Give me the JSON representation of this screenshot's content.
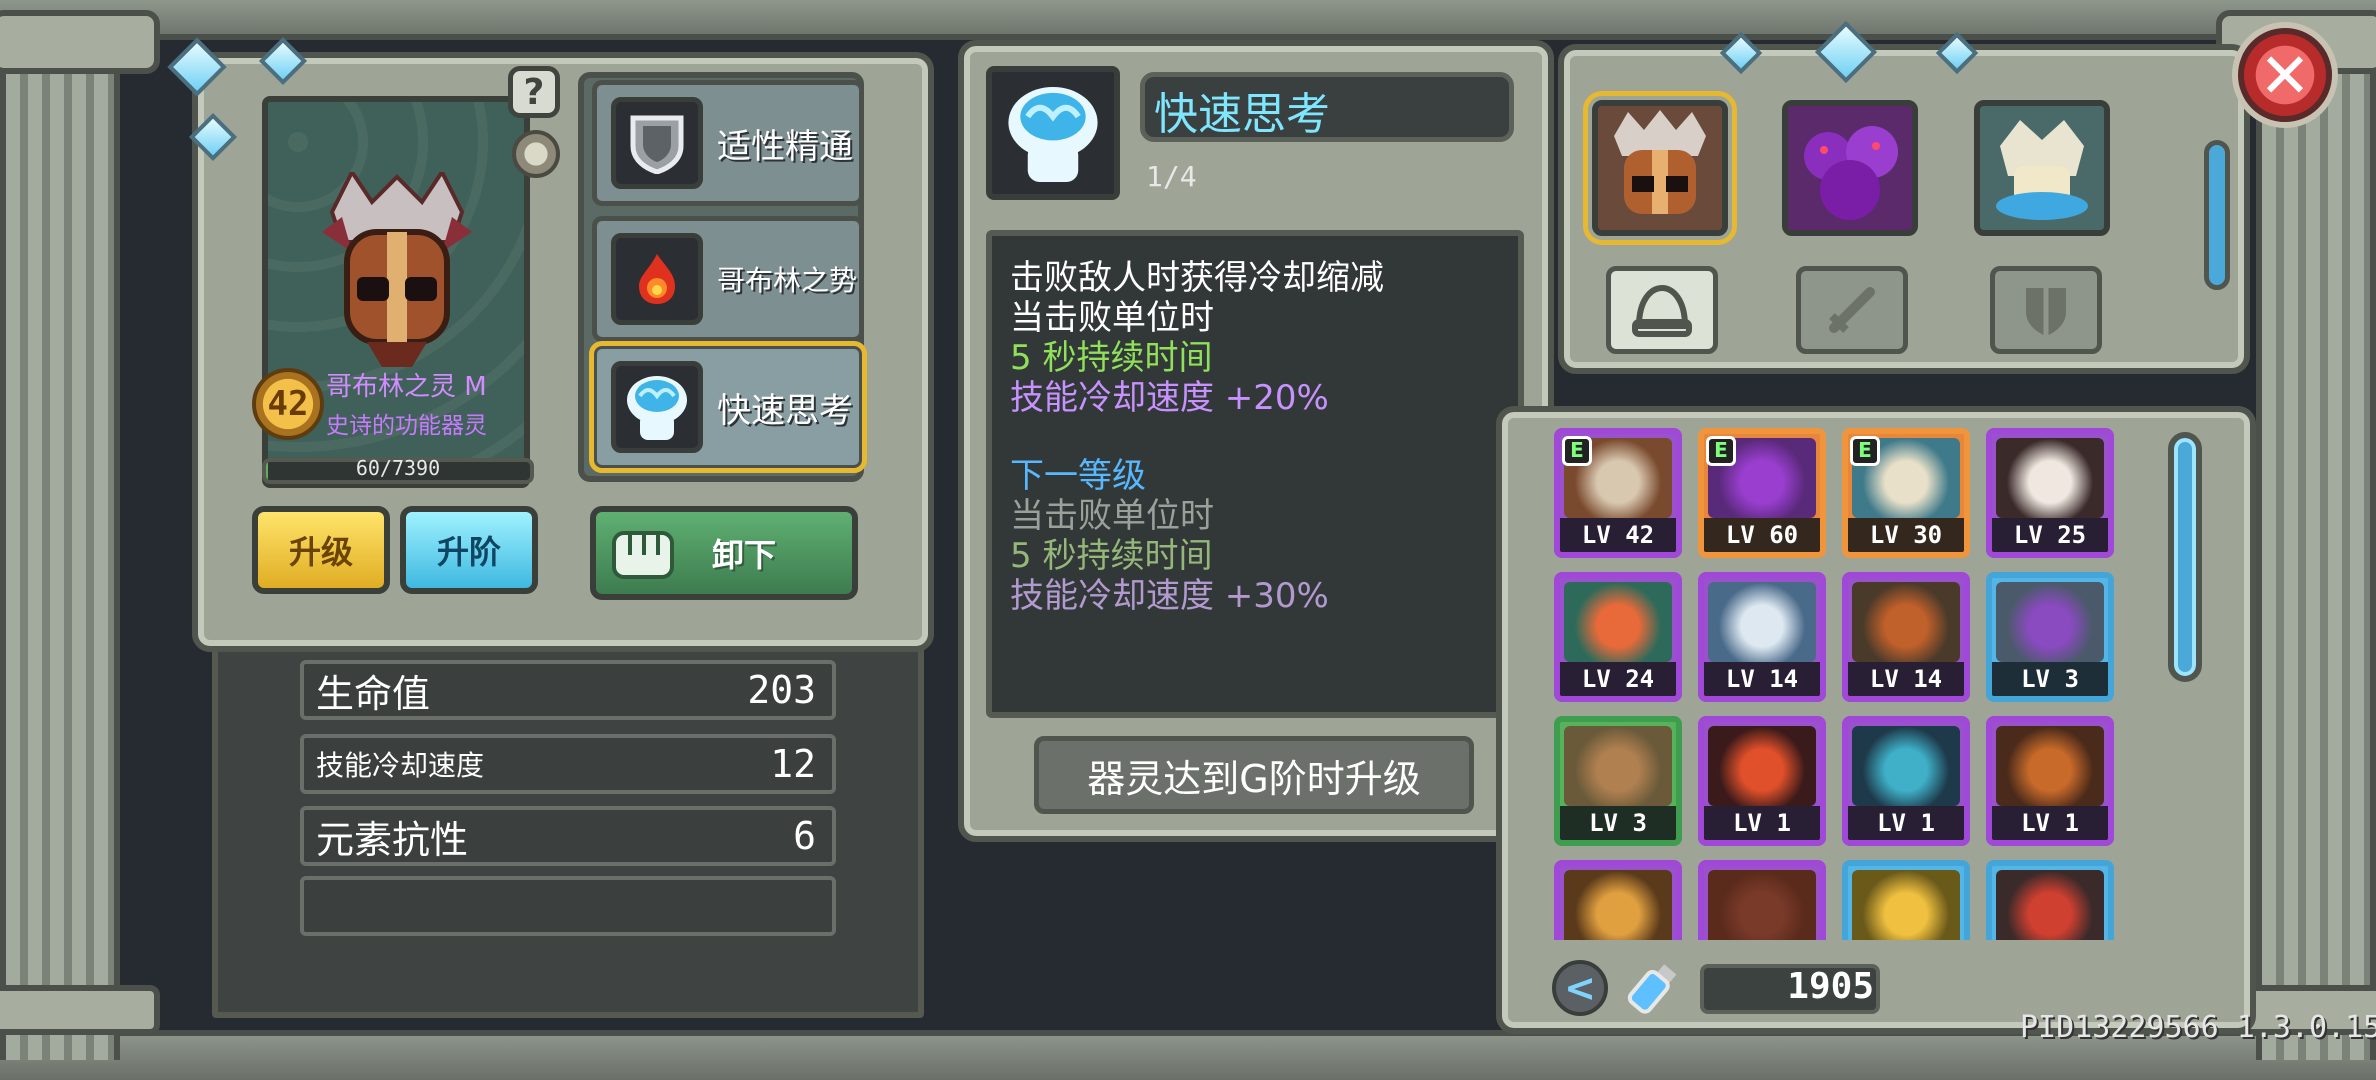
{
  "spirit": {
    "level": "42",
    "name": "哥布林之灵 M",
    "rarity": "史诗的功能器灵",
    "exp_text": "60/7390",
    "exp_fraction": 0.008
  },
  "help_label": "?",
  "skills": [
    {
      "label": "适性精通",
      "icon": "shield-icon"
    },
    {
      "label": "哥布林之势",
      "icon": "flame-icon"
    },
    {
      "label": "快速思考",
      "icon": "brain-icon",
      "selected": true
    }
  ],
  "buttons": {
    "upgrade": "升级",
    "ascend": "升阶",
    "unequip": "卸下"
  },
  "stats": [
    {
      "label": "生命值",
      "value": "203"
    },
    {
      "label": "技能冷却速度",
      "value": "12"
    },
    {
      "label": "元素抗性",
      "value": "6"
    },
    {
      "label": "",
      "value": ""
    }
  ],
  "detail": {
    "title": "快速思考",
    "level": "1/4",
    "lines": [
      {
        "text": "击败敌人时获得冷却缩减",
        "color": "white"
      },
      {
        "text": "当击败单位时",
        "color": "white"
      },
      {
        "text": "5 秒持续时间",
        "color": "green"
      },
      {
        "text": "技能冷却速度 +20%",
        "color": "purple"
      },
      {
        "text": "",
        "color": "white"
      },
      {
        "text": "下一等级",
        "color": "blue"
      },
      {
        "text": "当击败单位时",
        "color": "gray"
      },
      {
        "text": "5 秒持续时间",
        "color": "dimgreen"
      },
      {
        "text": "技能冷却速度 +30%",
        "color": "dimpurple"
      }
    ],
    "footer": "器灵达到G阶时升级"
  },
  "equip_slots": [
    "helmet-slot-icon",
    "sword-slot-icon",
    "shield-slot-icon"
  ],
  "inventory": [
    {
      "lv": "LV 42",
      "frame": "purple",
      "tag": "E"
    },
    {
      "lv": "LV 60",
      "frame": "orange",
      "tag": "E"
    },
    {
      "lv": "LV 30",
      "frame": "orange",
      "tag": "E"
    },
    {
      "lv": "LV 25",
      "frame": "purple",
      "tag": ""
    },
    {
      "lv": "LV 24",
      "frame": "purple",
      "tag": ""
    },
    {
      "lv": "LV 14",
      "frame": "purple",
      "tag": ""
    },
    {
      "lv": "LV 14",
      "frame": "purple",
      "tag": ""
    },
    {
      "lv": "LV 3",
      "frame": "blue",
      "tag": ""
    },
    {
      "lv": "LV 3",
      "frame": "green",
      "tag": ""
    },
    {
      "lv": "LV 1",
      "frame": "purple",
      "tag": ""
    },
    {
      "lv": "LV 1",
      "frame": "purple",
      "tag": ""
    },
    {
      "lv": "LV 1",
      "frame": "purple",
      "tag": ""
    },
    {
      "lv": "",
      "frame": "purple",
      "tag": ""
    },
    {
      "lv": "",
      "frame": "purple",
      "tag": ""
    },
    {
      "lv": "",
      "frame": "blue",
      "tag": ""
    },
    {
      "lv": "",
      "frame": "blue",
      "tag": ""
    }
  ],
  "currency": {
    "count": "1905",
    "back_label": "<"
  },
  "close_label": "✕",
  "version": "PID13229566 1.3.0.15",
  "colors": {
    "accent_blue": "#7fe6ff",
    "rarity_purple": "#c87aff",
    "selected_gold": "#e6b930",
    "stat_green": "#8fe05a"
  }
}
